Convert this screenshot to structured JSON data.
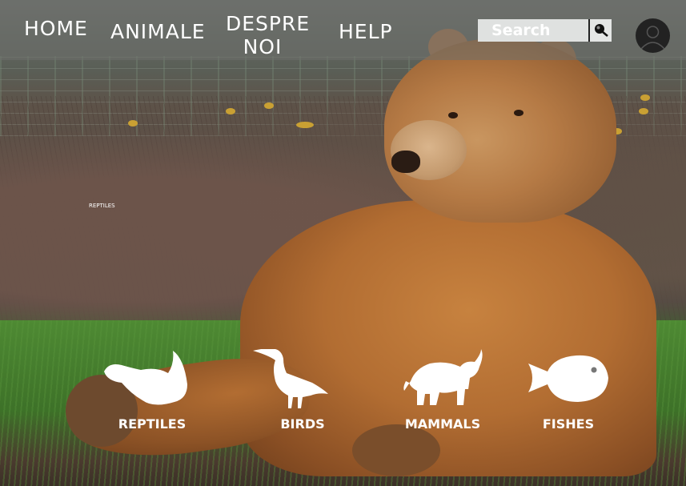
{
  "nav": {
    "home": "HOME",
    "animale": "ANIMALE",
    "despre_line1": "DESPRE",
    "despre_line2": "NOI",
    "help": "HELP"
  },
  "search": {
    "placeholder": "Search",
    "button_icon": "search-icon"
  },
  "profile": {
    "icon": "user-avatar-icon"
  },
  "hero": {
    "small_label": "REPTILES"
  },
  "categories": [
    {
      "label": "REPTILES",
      "icon": "platypus-icon"
    },
    {
      "label": "BIRDS",
      "icon": "heron-icon"
    },
    {
      "label": "MAMMALS",
      "icon": "elephant-icon"
    },
    {
      "label": "FISHES",
      "icon": "fish-icon"
    }
  ],
  "colors": {
    "nav_overlay": "#6e706c",
    "text": "#ffffff",
    "search_bg": "#dfe1e0",
    "avatar_bg": "#222222"
  }
}
